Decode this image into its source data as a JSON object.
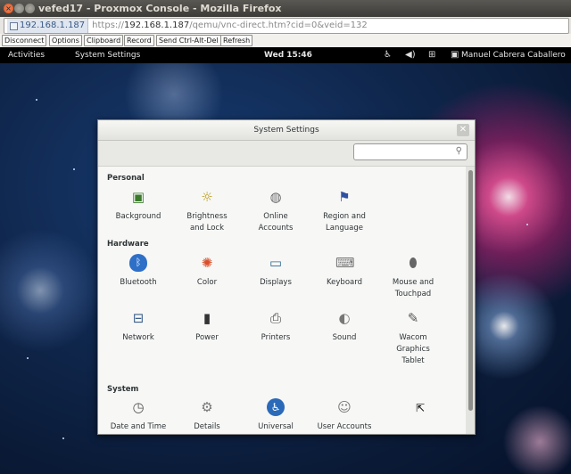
{
  "firefox": {
    "title": "vefed17 - Proxmox Console - Mozilla Firefox",
    "site_identity": "192.168.1.187",
    "url_prefix": "https://",
    "url_host": "192.168.1.187",
    "url_path": "/qemu/vnc-direct.htm?cid=0&veid=132"
  },
  "vnc_toolbar": {
    "buttons": [
      "Disconnect",
      "Options",
      "Clipboard",
      "Record",
      "Send Ctrl-Alt-Del",
      "Refresh"
    ]
  },
  "gnome_bar": {
    "activities": "Activities",
    "app_name": "System Settings",
    "clock": "Wed 15:46",
    "user": "Manuel Cabrera Caballero",
    "icons": [
      "accessibility-icon",
      "volume-icon",
      "network-icon"
    ]
  },
  "settings": {
    "title": "System Settings",
    "search_placeholder": "",
    "sections": [
      {
        "title": "Personal",
        "items": [
          {
            "label": "Background",
            "icon": "background-icon"
          },
          {
            "label": "Brightness\nand Lock",
            "icon": "brightness-icon"
          },
          {
            "label": "Online\nAccounts",
            "icon": "online-accounts-icon"
          },
          {
            "label": "Region and\nLanguage",
            "icon": "region-flag-icon"
          }
        ]
      },
      {
        "title": "Hardware",
        "items": [
          {
            "label": "Bluetooth",
            "icon": "bluetooth-icon"
          },
          {
            "label": "Color",
            "icon": "color-icon"
          },
          {
            "label": "Displays",
            "icon": "displays-icon"
          },
          {
            "label": "Keyboard",
            "icon": "keyboard-icon"
          },
          {
            "label": "Mouse and\nTouchpad",
            "icon": "mouse-icon"
          },
          {
            "label": "Network",
            "icon": "network-icon"
          },
          {
            "label": "Power",
            "icon": "power-icon"
          },
          {
            "label": "Printers",
            "icon": "printer-icon"
          },
          {
            "label": "Sound",
            "icon": "sound-icon"
          },
          {
            "label": "Wacom\nGraphics\nTablet",
            "icon": "wacom-tablet-icon"
          }
        ]
      },
      {
        "title": "System",
        "items": [
          {
            "label": "Date and Time",
            "icon": "clock-icon"
          },
          {
            "label": "Details",
            "icon": "details-icon"
          },
          {
            "label": "Universal",
            "icon": "universal-access-icon"
          },
          {
            "label": "User Accounts",
            "icon": "users-icon"
          }
        ]
      }
    ]
  },
  "colors": {
    "topbar": "#000000",
    "desktop": "#10284f",
    "bluetooth": "#2e6fc7",
    "universal": "#2a6ab8"
  }
}
